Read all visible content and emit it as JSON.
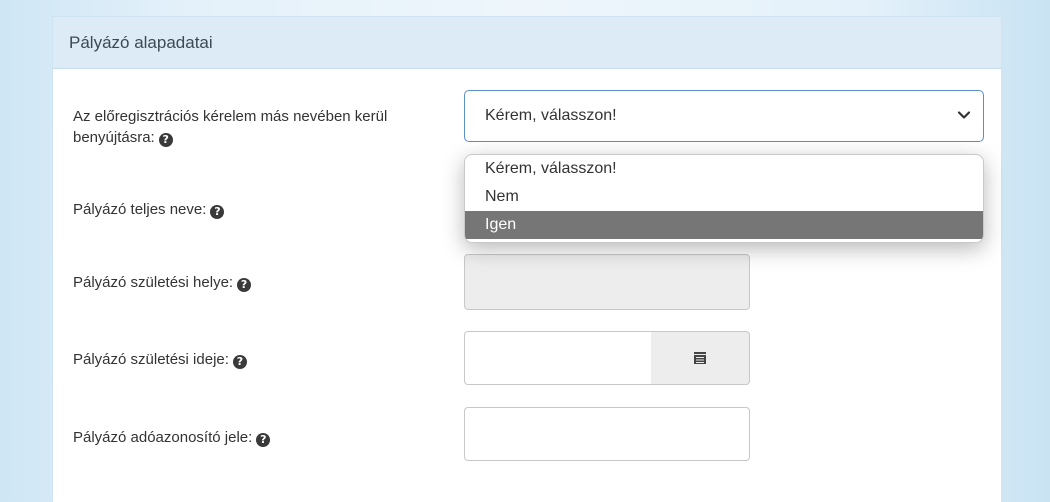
{
  "panel": {
    "title": "Pályázó alapadatai"
  },
  "fields": [
    {
      "label": "Az előregisztrációs kérelem más nevében kerül benyújtásra:",
      "help": "?"
    },
    {
      "label": "Pályázó teljes neve:",
      "help": "?"
    },
    {
      "label": "Pályázó születési helye:",
      "help": "?"
    },
    {
      "label": "Pályázó születési ideje:",
      "help": "?"
    },
    {
      "label": "Pályázó adóazonosító jele:",
      "help": "?"
    }
  ],
  "select": {
    "value": "Kérem, válasszon!",
    "options": [
      "Kérem, válasszon!",
      "Nem",
      "Igen"
    ],
    "highlighted": "Igen"
  }
}
